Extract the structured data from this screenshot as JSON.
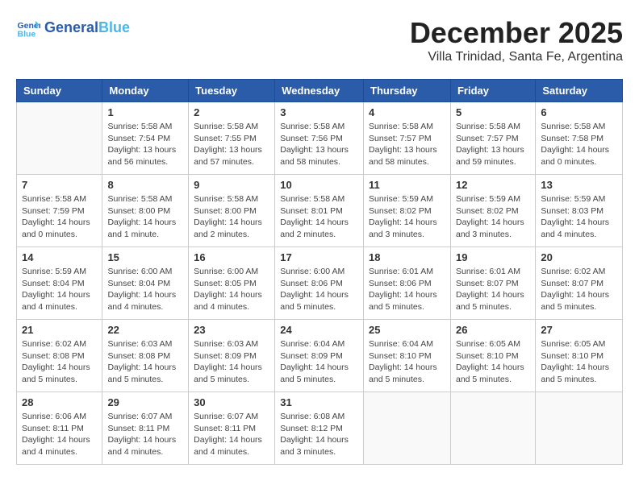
{
  "logo": {
    "line1": "General",
    "line2": "Blue"
  },
  "title": "December 2025",
  "subtitle": "Villa Trinidad, Santa Fe, Argentina",
  "weekdays": [
    "Sunday",
    "Monday",
    "Tuesday",
    "Wednesday",
    "Thursday",
    "Friday",
    "Saturday"
  ],
  "weeks": [
    [
      {
        "day": "",
        "info": ""
      },
      {
        "day": "1",
        "info": "Sunrise: 5:58 AM\nSunset: 7:54 PM\nDaylight: 13 hours\nand 56 minutes."
      },
      {
        "day": "2",
        "info": "Sunrise: 5:58 AM\nSunset: 7:55 PM\nDaylight: 13 hours\nand 57 minutes."
      },
      {
        "day": "3",
        "info": "Sunrise: 5:58 AM\nSunset: 7:56 PM\nDaylight: 13 hours\nand 58 minutes."
      },
      {
        "day": "4",
        "info": "Sunrise: 5:58 AM\nSunset: 7:57 PM\nDaylight: 13 hours\nand 58 minutes."
      },
      {
        "day": "5",
        "info": "Sunrise: 5:58 AM\nSunset: 7:57 PM\nDaylight: 13 hours\nand 59 minutes."
      },
      {
        "day": "6",
        "info": "Sunrise: 5:58 AM\nSunset: 7:58 PM\nDaylight: 14 hours\nand 0 minutes."
      }
    ],
    [
      {
        "day": "7",
        "info": "Sunrise: 5:58 AM\nSunset: 7:59 PM\nDaylight: 14 hours\nand 0 minutes."
      },
      {
        "day": "8",
        "info": "Sunrise: 5:58 AM\nSunset: 8:00 PM\nDaylight: 14 hours\nand 1 minute."
      },
      {
        "day": "9",
        "info": "Sunrise: 5:58 AM\nSunset: 8:00 PM\nDaylight: 14 hours\nand 2 minutes."
      },
      {
        "day": "10",
        "info": "Sunrise: 5:58 AM\nSunset: 8:01 PM\nDaylight: 14 hours\nand 2 minutes."
      },
      {
        "day": "11",
        "info": "Sunrise: 5:59 AM\nSunset: 8:02 PM\nDaylight: 14 hours\nand 3 minutes."
      },
      {
        "day": "12",
        "info": "Sunrise: 5:59 AM\nSunset: 8:02 PM\nDaylight: 14 hours\nand 3 minutes."
      },
      {
        "day": "13",
        "info": "Sunrise: 5:59 AM\nSunset: 8:03 PM\nDaylight: 14 hours\nand 4 minutes."
      }
    ],
    [
      {
        "day": "14",
        "info": "Sunrise: 5:59 AM\nSunset: 8:04 PM\nDaylight: 14 hours\nand 4 minutes."
      },
      {
        "day": "15",
        "info": "Sunrise: 6:00 AM\nSunset: 8:04 PM\nDaylight: 14 hours\nand 4 minutes."
      },
      {
        "day": "16",
        "info": "Sunrise: 6:00 AM\nSunset: 8:05 PM\nDaylight: 14 hours\nand 4 minutes."
      },
      {
        "day": "17",
        "info": "Sunrise: 6:00 AM\nSunset: 8:06 PM\nDaylight: 14 hours\nand 5 minutes."
      },
      {
        "day": "18",
        "info": "Sunrise: 6:01 AM\nSunset: 8:06 PM\nDaylight: 14 hours\nand 5 minutes."
      },
      {
        "day": "19",
        "info": "Sunrise: 6:01 AM\nSunset: 8:07 PM\nDaylight: 14 hours\nand 5 minutes."
      },
      {
        "day": "20",
        "info": "Sunrise: 6:02 AM\nSunset: 8:07 PM\nDaylight: 14 hours\nand 5 minutes."
      }
    ],
    [
      {
        "day": "21",
        "info": "Sunrise: 6:02 AM\nSunset: 8:08 PM\nDaylight: 14 hours\nand 5 minutes."
      },
      {
        "day": "22",
        "info": "Sunrise: 6:03 AM\nSunset: 8:08 PM\nDaylight: 14 hours\nand 5 minutes."
      },
      {
        "day": "23",
        "info": "Sunrise: 6:03 AM\nSunset: 8:09 PM\nDaylight: 14 hours\nand 5 minutes."
      },
      {
        "day": "24",
        "info": "Sunrise: 6:04 AM\nSunset: 8:09 PM\nDaylight: 14 hours\nand 5 minutes."
      },
      {
        "day": "25",
        "info": "Sunrise: 6:04 AM\nSunset: 8:10 PM\nDaylight: 14 hours\nand 5 minutes."
      },
      {
        "day": "26",
        "info": "Sunrise: 6:05 AM\nSunset: 8:10 PM\nDaylight: 14 hours\nand 5 minutes."
      },
      {
        "day": "27",
        "info": "Sunrise: 6:05 AM\nSunset: 8:10 PM\nDaylight: 14 hours\nand 5 minutes."
      }
    ],
    [
      {
        "day": "28",
        "info": "Sunrise: 6:06 AM\nSunset: 8:11 PM\nDaylight: 14 hours\nand 4 minutes."
      },
      {
        "day": "29",
        "info": "Sunrise: 6:07 AM\nSunset: 8:11 PM\nDaylight: 14 hours\nand 4 minutes."
      },
      {
        "day": "30",
        "info": "Sunrise: 6:07 AM\nSunset: 8:11 PM\nDaylight: 14 hours\nand 4 minutes."
      },
      {
        "day": "31",
        "info": "Sunrise: 6:08 AM\nSunset: 8:12 PM\nDaylight: 14 hours\nand 3 minutes."
      },
      {
        "day": "",
        "info": ""
      },
      {
        "day": "",
        "info": ""
      },
      {
        "day": "",
        "info": ""
      }
    ]
  ]
}
